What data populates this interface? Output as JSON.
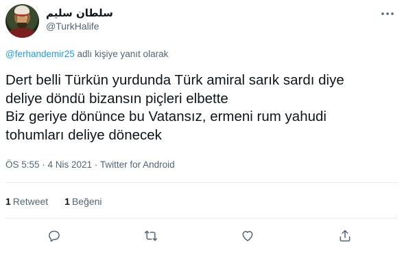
{
  "author": {
    "display_name": "سلطان سليم",
    "username": "@TurkHalife",
    "avatar_icon": "avatar-portrait"
  },
  "reply_context": {
    "mention": "@ferhandemir25",
    "suffix": " adlı kişiye yanıt olarak"
  },
  "tweet": {
    "text": "Dert belli Türkün yurdunda Türk amiral sarık sardı diye\ndeliye döndü bizansın piçleri elbette\nBiz geriye dönünce bu Vatansız, ermeni rum yahudi\ntohumları deliye dönecek"
  },
  "meta": {
    "time": "ÖS 5:55",
    "date": "4 Nis 2021",
    "source": "Twitter for Android",
    "separator": " · "
  },
  "stats": {
    "retweets_count": "1",
    "retweets_label": "Retweet",
    "likes_count": "1",
    "likes_label": "Beğeni"
  },
  "actions": [
    {
      "name": "reply",
      "icon": "reply-icon"
    },
    {
      "name": "retweet",
      "icon": "retweet-icon"
    },
    {
      "name": "like",
      "icon": "heart-icon"
    },
    {
      "name": "share",
      "icon": "share-icon"
    }
  ],
  "colors": {
    "text": "#0f1419",
    "secondary": "#536471",
    "accent": "#1d9bf0",
    "divider": "#e6ecf0"
  }
}
